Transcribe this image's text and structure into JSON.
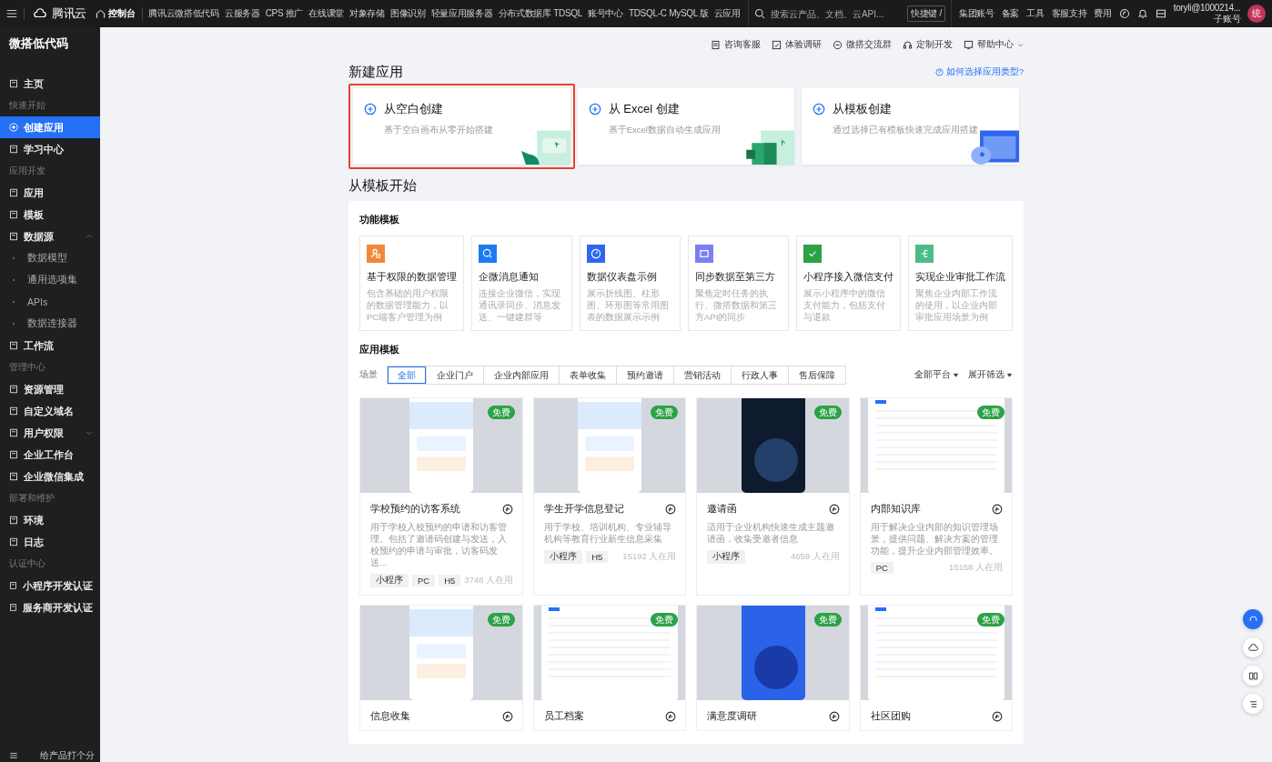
{
  "topbar": {
    "brand": "腾讯云",
    "console": "控制台",
    "nav": [
      "腾讯云微搭低代码",
      "云服务器",
      "CPS 推广",
      "在线课堂",
      "对象存储",
      "图像识别",
      "轻量应用服务器",
      "分布式数据库 TDSQL",
      "账号中心",
      "TDSQL-C MySQL 版",
      "云应用"
    ],
    "search": {
      "placeholder": "搜索云产品、文档、云API..."
    },
    "shortcut": "快捷键 /",
    "links": [
      "集团账号",
      "备案",
      "工具",
      "客服支持",
      "费用"
    ],
    "user": {
      "name": "toryli@1000214...",
      "role": "子账号",
      "avatar": "统"
    }
  },
  "sidebar": {
    "title": "微搭低代码",
    "items": [
      {
        "kind": "item",
        "label": "主页",
        "selected": false
      },
      {
        "kind": "group",
        "label": "快速开始"
      },
      {
        "kind": "item",
        "label": "创建应用",
        "selected": true
      },
      {
        "kind": "item",
        "label": "学习中心",
        "selected": false
      },
      {
        "kind": "group",
        "label": "应用开发"
      },
      {
        "kind": "item",
        "label": "应用",
        "selected": false
      },
      {
        "kind": "item",
        "label": "模板",
        "selected": false
      },
      {
        "kind": "item",
        "label": "数据源",
        "selected": false,
        "expanded": true,
        "children": [
          {
            "label": "数据模型"
          },
          {
            "label": "通用选项集"
          },
          {
            "label": "APIs"
          },
          {
            "label": "数据连接器"
          }
        ]
      },
      {
        "kind": "item",
        "label": "工作流",
        "selected": false
      },
      {
        "kind": "group",
        "label": "管理中心"
      },
      {
        "kind": "item",
        "label": "资源管理",
        "selected": false
      },
      {
        "kind": "item",
        "label": "自定义域名",
        "selected": false
      },
      {
        "kind": "item",
        "label": "用户权限",
        "selected": false,
        "expanded": false
      },
      {
        "kind": "item",
        "label": "企业工作台",
        "selected": false
      },
      {
        "kind": "item",
        "label": "企业微信集成",
        "selected": false
      },
      {
        "kind": "group",
        "label": "部署和维护"
      },
      {
        "kind": "item",
        "label": "环境",
        "selected": false
      },
      {
        "kind": "item",
        "label": "日志",
        "selected": false
      },
      {
        "kind": "group",
        "label": "认证中心"
      },
      {
        "kind": "item",
        "label": "小程序开发认证",
        "selected": false
      },
      {
        "kind": "item",
        "label": "服务商开发认证",
        "selected": false
      }
    ],
    "footer": "给产品打个分"
  },
  "help_links": [
    "咨询客服",
    "体验调研",
    "微搭交流群",
    "定制开发",
    "帮助中心"
  ],
  "new_app": {
    "title": "新建应用",
    "help_link": "如何选择应用类型?",
    "options": [
      {
        "title": "从空白创建",
        "desc": "基于空白画布从零开始搭建",
        "selected": true
      },
      {
        "title": "从 Excel 创建",
        "desc": "基于Excel数据自动生成应用",
        "selected": false
      },
      {
        "title": "从模板创建",
        "desc": "通过选择已有模板快速完成应用搭建",
        "selected": false
      }
    ]
  },
  "templates": {
    "title": "从模板开始",
    "function_title": "功能模板",
    "functions": [
      {
        "title": "基于权限的数据管理",
        "desc": "包含基础的用户权限的数据管理能力，以PC端客户管理为例",
        "color": "#f0883a"
      },
      {
        "title": "企微消息通知",
        "desc": "连接企业微信，实现通讯录同步、消息发送、一键建群等",
        "color": "#1c7bf0"
      },
      {
        "title": "数据仪表盘示例",
        "desc": "展示折线图、柱形图、环形图等常用图表的数据展示示例",
        "color": "#2f66f0"
      },
      {
        "title": "同步数据至第三方",
        "desc": "聚焦定时任务的执行、微搭数据和第三方API的同步",
        "color": "#7b7ff4"
      },
      {
        "title": "小程序接入微信支付",
        "desc": "展示小程序中的微信支付能力，包括支付与退款",
        "color": "#2ba246"
      },
      {
        "title": "实现企业审批工作流",
        "desc": "聚焦企业内部工作流的使用，以企业内部审批应用场景为例",
        "color": "#4cbb88"
      }
    ],
    "app_title": "应用模板",
    "filter_label": "场景",
    "filters": [
      {
        "label": "全部",
        "selected": true
      },
      {
        "label": "企业门户",
        "selected": false
      },
      {
        "label": "企业内部应用",
        "selected": false
      },
      {
        "label": "表单收集",
        "selected": false
      },
      {
        "label": "预约邀请",
        "selected": false
      },
      {
        "label": "营销活动",
        "selected": false
      },
      {
        "label": "行政人事",
        "selected": false
      },
      {
        "label": "售后保障",
        "selected": false
      }
    ],
    "platform": "全部平台",
    "expand": "展开筛选",
    "apps": [
      {
        "title": "学校预约的访客系统",
        "desc": "用于学校入校预约的申请和访客管理。包括了邀请码创建与发送，入校预约的申请与审批，访客码发送...",
        "tags": [
          "小程序",
          "PC",
          "H5"
        ],
        "usage": "3748 人在用",
        "badge": "免费"
      },
      {
        "title": "学生开学信息登记",
        "desc": "用于学校、培训机构、专业辅导机构等教育行业新生信息采集",
        "tags": [
          "小程序",
          "H5"
        ],
        "usage": "15192 人在用",
        "badge": "免费"
      },
      {
        "title": "邀请函",
        "desc": "适用于企业机构快速生成主题邀请函，收集受邀者信息",
        "tags": [
          "小程序"
        ],
        "usage": "4659 人在用",
        "badge": "免费"
      },
      {
        "title": "内部知识库",
        "desc": "用于解决企业内部的知识管理场景，提供问题、解决方案的管理功能，提升企业内部管理效率。",
        "tags": [
          "PC"
        ],
        "usage": "15158 人在用",
        "badge": "免费"
      },
      {
        "title": "信息收集",
        "badge": "免费"
      },
      {
        "title": "员工档案",
        "badge": "免费"
      },
      {
        "title": "满意度调研",
        "badge": "免费"
      },
      {
        "title": "社区团购",
        "badge": "免费"
      }
    ]
  }
}
